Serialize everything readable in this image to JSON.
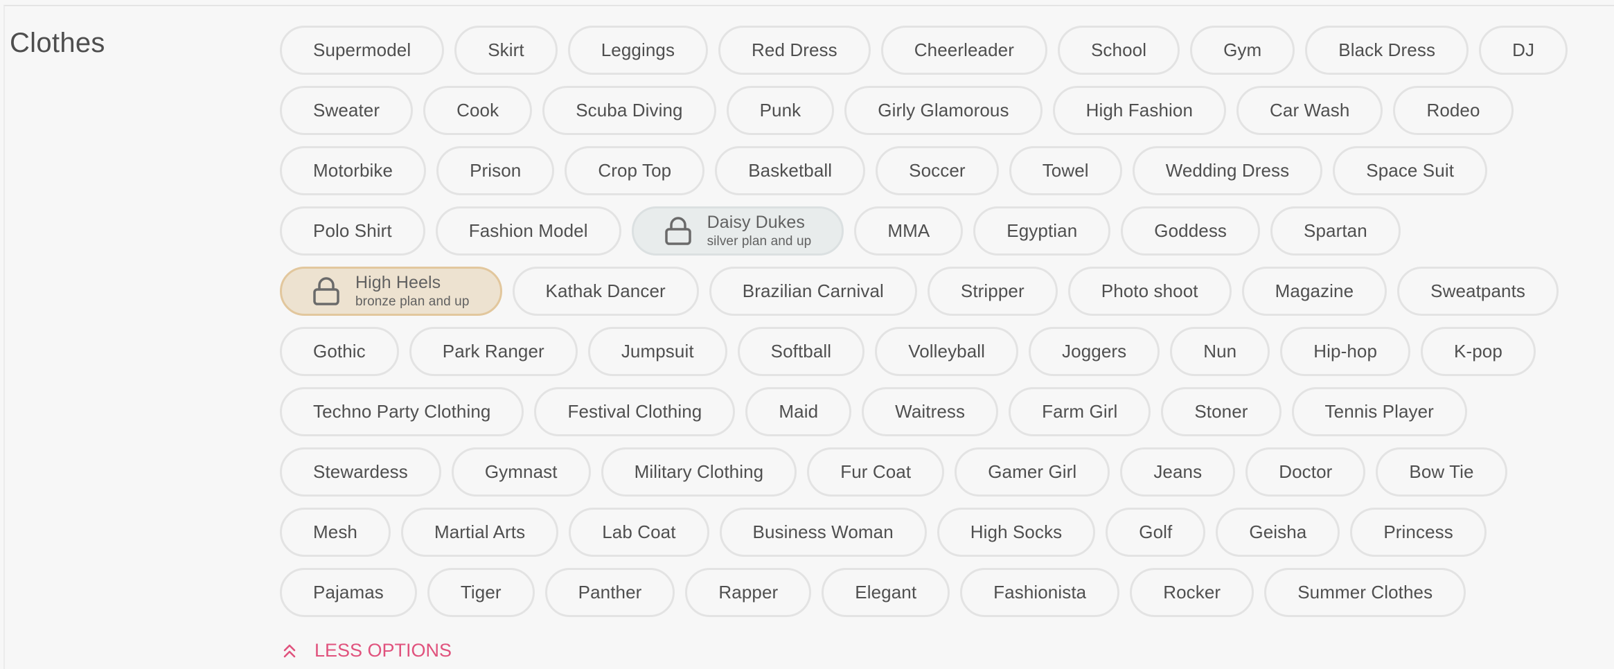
{
  "section": {
    "title": "Clothes"
  },
  "rows": [
    [
      {
        "label": "Supermodel"
      },
      {
        "label": "Skirt"
      },
      {
        "label": "Leggings"
      },
      {
        "label": "Red Dress"
      },
      {
        "label": "Cheerleader"
      },
      {
        "label": "School"
      },
      {
        "label": "Gym"
      },
      {
        "label": "Black Dress"
      },
      {
        "label": "DJ"
      }
    ],
    [
      {
        "label": "Sweater"
      },
      {
        "label": "Cook"
      },
      {
        "label": "Scuba Diving"
      },
      {
        "label": "Punk"
      },
      {
        "label": "Girly Glamorous"
      },
      {
        "label": "High Fashion"
      },
      {
        "label": "Car Wash"
      },
      {
        "label": "Rodeo"
      }
    ],
    [
      {
        "label": "Motorbike"
      },
      {
        "label": "Prison"
      },
      {
        "label": "Crop Top"
      },
      {
        "label": "Basketball"
      },
      {
        "label": "Soccer"
      },
      {
        "label": "Towel"
      },
      {
        "label": "Wedding Dress"
      },
      {
        "label": "Space Suit"
      }
    ],
    [
      {
        "label": "Polo Shirt"
      },
      {
        "label": "Fashion Model"
      },
      {
        "label": "Daisy Dukes",
        "locked": true,
        "plan": "silver plan and up",
        "tier": "silver"
      },
      {
        "label": "MMA"
      },
      {
        "label": "Egyptian"
      },
      {
        "label": "Goddess"
      },
      {
        "label": "Spartan"
      }
    ],
    [
      {
        "label": "High Heels",
        "locked": true,
        "plan": "bronze plan and up",
        "tier": "bronze"
      },
      {
        "label": "Kathak Dancer"
      },
      {
        "label": "Brazilian Carnival"
      },
      {
        "label": "Stripper"
      },
      {
        "label": "Photo shoot"
      },
      {
        "label": "Magazine"
      },
      {
        "label": "Sweatpants"
      }
    ],
    [
      {
        "label": "Gothic"
      },
      {
        "label": "Park Ranger"
      },
      {
        "label": "Jumpsuit"
      },
      {
        "label": "Softball"
      },
      {
        "label": "Volleyball"
      },
      {
        "label": "Joggers"
      },
      {
        "label": "Nun"
      },
      {
        "label": "Hip-hop"
      },
      {
        "label": "K-pop"
      }
    ],
    [
      {
        "label": "Techno Party Clothing"
      },
      {
        "label": "Festival Clothing"
      },
      {
        "label": "Maid"
      },
      {
        "label": "Waitress"
      },
      {
        "label": "Farm Girl"
      },
      {
        "label": "Stoner"
      },
      {
        "label": "Tennis Player"
      }
    ],
    [
      {
        "label": "Stewardess"
      },
      {
        "label": "Gymnast"
      },
      {
        "label": "Military Clothing"
      },
      {
        "label": "Fur Coat"
      },
      {
        "label": "Gamer Girl"
      },
      {
        "label": "Jeans"
      },
      {
        "label": "Doctor"
      },
      {
        "label": "Bow Tie"
      }
    ],
    [
      {
        "label": "Mesh"
      },
      {
        "label": "Martial Arts"
      },
      {
        "label": "Lab Coat"
      },
      {
        "label": "Business Woman"
      },
      {
        "label": "High Socks"
      },
      {
        "label": "Golf"
      },
      {
        "label": "Geisha"
      },
      {
        "label": "Princess"
      }
    ],
    [
      {
        "label": "Pajamas"
      },
      {
        "label": "Tiger"
      },
      {
        "label": "Panther"
      },
      {
        "label": "Rapper"
      },
      {
        "label": "Elegant"
      },
      {
        "label": "Fashionista"
      },
      {
        "label": "Rocker"
      },
      {
        "label": "Summer Clothes"
      }
    ]
  ],
  "less_options": {
    "label": "LESS OPTIONS",
    "icon": "double-chevron-up-icon"
  },
  "colors": {
    "accent": "#e0527d",
    "text": "#4f4f4f",
    "pill_border": "#e3e3e3",
    "silver_bg": "#e8ecec",
    "bronze_bg": "#ede2d0",
    "bronze_border": "#e2c79d"
  }
}
